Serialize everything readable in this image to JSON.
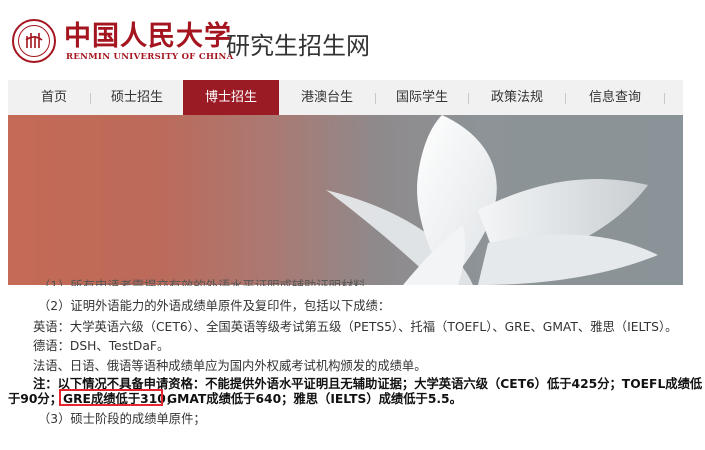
{
  "header": {
    "logo_cn": "中国人民大学",
    "logo_en": "RENMIN UNIVERSITY OF CHINA",
    "site_title": "研究生招生网"
  },
  "nav": {
    "items": [
      {
        "label": "首页"
      },
      {
        "label": "硕士招生"
      },
      {
        "label": "博士招生",
        "active": true
      },
      {
        "label": "港澳台生"
      },
      {
        "label": "国际学生"
      },
      {
        "label": "政策法规"
      },
      {
        "label": "信息查询"
      }
    ]
  },
  "content": {
    "lines": [
      "（2）证明外语能力的外语成绩单原件及复印件，包括以下成绩：",
      "英语：大学英语六级（CET6）、全国英语等级考试第五级（PETS5）、托福（TOEFL）、GRE、GMAT、雅思（IELTS）。",
      "德语：DSH、TestDaF。",
      "法语、日语、俄语等语种成绩单应为国内外权威考试机构颁发的成绩单。",
      "注：以下情况不具备申请资格：不能提供外语水平证明且无辅助证据；大学英语六级（CET6）低于425分；TOEFL成绩低",
      "于90分；",
      "GRE成绩低于310，",
      "GMAT成绩低于640；雅思（IELTS）成绩低于5.5。",
      "（3）硕士阶段的成绩单原件；"
    ]
  },
  "colors": {
    "brand_red": "#a4151f",
    "nav_active": "#9b1b24",
    "highlight_box": "#e3262f"
  },
  "icons": {
    "seal": "university-seal-icon"
  }
}
